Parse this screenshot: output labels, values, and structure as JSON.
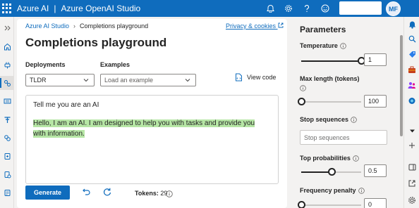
{
  "header": {
    "brand": "Azure AI",
    "separator": "|",
    "product": "Azure OpenAI Studio",
    "avatar_initials": "MF"
  },
  "breadcrumb": {
    "root": "Azure AI Studio",
    "current": "Completions playground",
    "privacy": "Privacy & cookies"
  },
  "page": {
    "title": "Completions playground"
  },
  "deployments": {
    "label": "Deployments",
    "value": "TLDR"
  },
  "examples": {
    "label": "Examples",
    "placeholder": "Load an example"
  },
  "view_code": "View code",
  "editor": {
    "prompt": "Tell me you are an AI",
    "completion": "Hello, I am an AI. I am designed to help you with tasks and provide you with information."
  },
  "actions": {
    "generate": "Generate",
    "tokens_label": "Tokens:",
    "tokens_value": "29"
  },
  "parameters": {
    "title": "Parameters",
    "temperature": {
      "label": "Temperature",
      "value": "1",
      "fraction": 1.0
    },
    "max_length": {
      "label": "Max length (tokens)",
      "value": "100",
      "fraction": 0.0
    },
    "stop_sequences": {
      "label": "Stop sequences",
      "placeholder": "Stop sequences"
    },
    "top_p": {
      "label": "Top probabilities",
      "value": "0.5",
      "fraction": 0.5
    },
    "frequency_penalty": {
      "label": "Frequency penalty",
      "value": "0",
      "fraction": 0.0
    }
  },
  "colors": {
    "accent": "#0f6cbd",
    "highlight": "#b6e6a5"
  }
}
